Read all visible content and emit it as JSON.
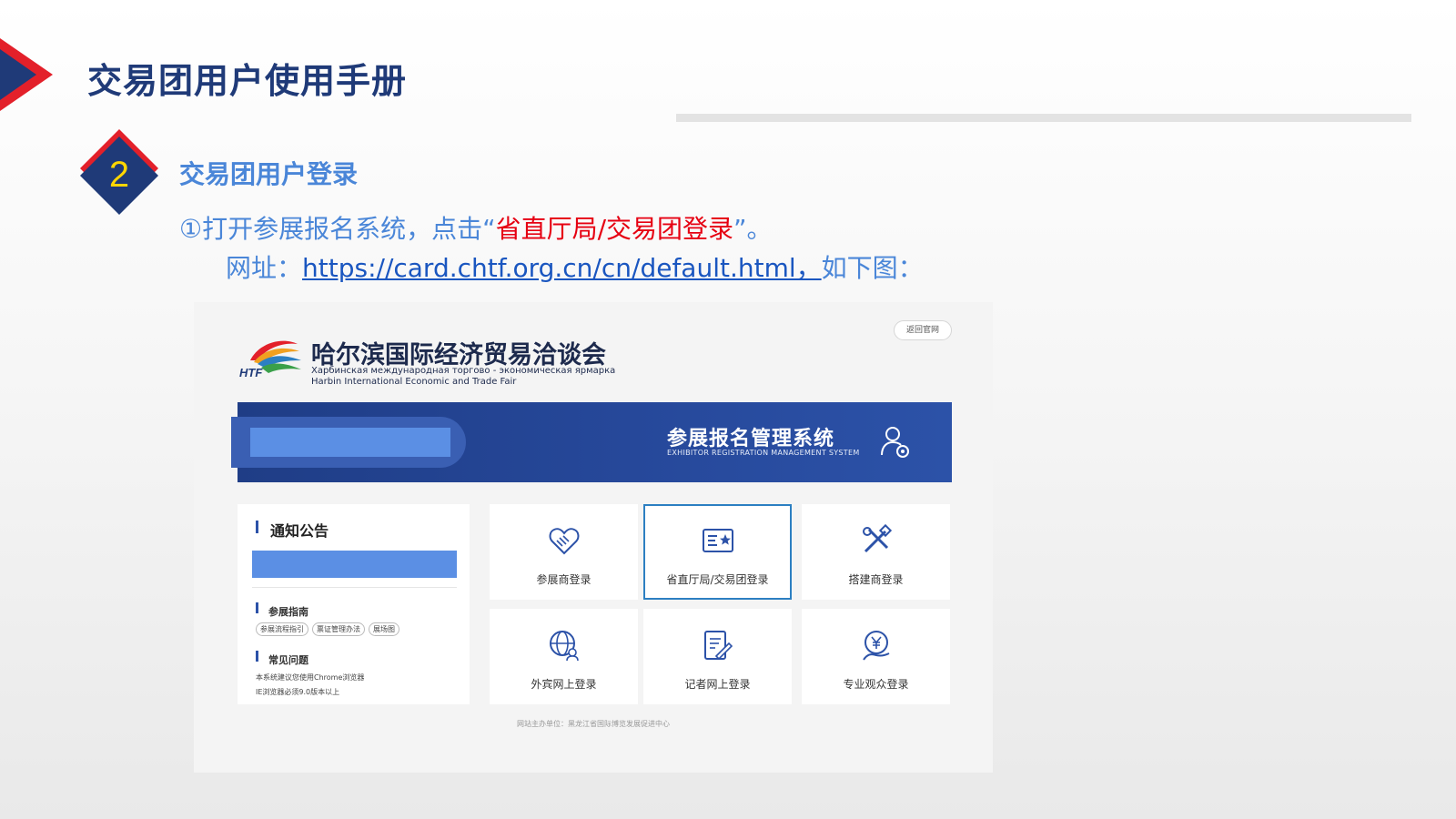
{
  "slide": {
    "title": "交易团用户使用手册",
    "step_number": "2",
    "section_title": "交易团用户登录",
    "instruction_prefix": "①打开参展报名系统，点击“",
    "instruction_highlight": "省直厅局/交易团登录",
    "instruction_suffix": "”。",
    "url_label": "网址：",
    "url": "https://card.chtf.org.cn/cn/default.html，",
    "url_suffix": "如下图："
  },
  "colors": {
    "title": "#1f3a78",
    "section": "#4a86d8",
    "highlight": "#e60012",
    "banner": "#26489a",
    "redaction": "#5b8fe4",
    "active_tile_border": "#2c7fc2"
  },
  "screenshot": {
    "back_button": "返回官网",
    "logo_text": "HTF",
    "fair_name_cn": "哈尔滨国际经济贸易洽谈会",
    "fair_name_ru": "Харбинская международная торгово - экономическая ярмарка",
    "fair_name_en": "Harbin International Economic and Trade Fair",
    "system_name_cn": "参展报名管理系统",
    "system_name_en": "EXHIBITOR REGISTRATION MANAGEMENT SYSTEM",
    "notice": {
      "title": "通知公告",
      "guide_title": "参展指南",
      "guide_tags": [
        "参展流程指引",
        "票证管理办法",
        "展场图"
      ],
      "faq_title": "常见问题",
      "faq_items": [
        "本系统建议您使用Chrome浏览器",
        "IE浏览器必须9.0版本以上"
      ]
    },
    "tiles": [
      {
        "label": "参展商登录",
        "icon": "handshake-icon",
        "active": false
      },
      {
        "label": "省直厅局/交易团登录",
        "icon": "id-card-star-icon",
        "active": true
      },
      {
        "label": "搭建商登录",
        "icon": "tools-icon",
        "active": false
      },
      {
        "label": "外宾网上登录",
        "icon": "globe-user-icon",
        "active": false
      },
      {
        "label": "记者网上登录",
        "icon": "document-pen-icon",
        "active": false
      },
      {
        "label": "专业观众登录",
        "icon": "yuan-user-icon",
        "active": false
      }
    ],
    "footer": "网站主办单位：黑龙江省国际博览发展促进中心"
  }
}
